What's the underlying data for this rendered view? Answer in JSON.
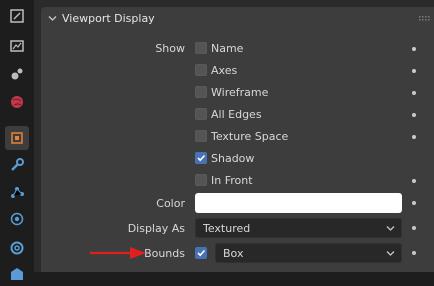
{
  "sidebar": {
    "tabs": [
      {
        "name": "tool-icon",
        "active": false
      },
      {
        "name": "render-icon",
        "active": false
      },
      {
        "name": "output-icon",
        "active": false
      },
      {
        "name": "view-layer-icon",
        "active": false
      },
      {
        "name": "scene-icon",
        "active": false
      },
      {
        "name": "world-icon",
        "active": false
      },
      {
        "name": "object-icon",
        "active": true
      },
      {
        "name": "modifier-wrench-icon",
        "active": false
      },
      {
        "name": "particles-icon",
        "active": false
      },
      {
        "name": "physics-icon",
        "active": false
      },
      {
        "name": "constraints-icon",
        "active": false
      }
    ]
  },
  "panel": {
    "title": "Viewport Display",
    "show_label": "Show",
    "options": [
      {
        "label": "Name",
        "checked": false
      },
      {
        "label": "Axes",
        "checked": false
      },
      {
        "label": "Wireframe",
        "checked": false
      },
      {
        "label": "All Edges",
        "checked": false
      },
      {
        "label": "Texture Space",
        "checked": false
      },
      {
        "label": "Shadow",
        "checked": true
      },
      {
        "label": "In Front",
        "checked": false
      }
    ],
    "color_label": "Color",
    "color_value": "#ffffff",
    "display_as_label": "Display As",
    "display_as_value": "Textured",
    "bounds_label": "Bounds",
    "bounds_checked": true,
    "bounds_value": "Box"
  },
  "colors": {
    "accent": "#4772b3",
    "annotation_arrow": "#e02020"
  }
}
